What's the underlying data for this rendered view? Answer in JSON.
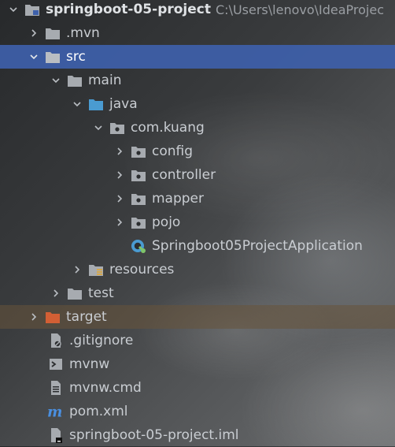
{
  "project": {
    "name": "springboot-05-project",
    "path": "C:\\Users\\lenovo\\IdeaProjec"
  },
  "tree": {
    "mvn": ".mvn",
    "src": "src",
    "main": "main",
    "java": "java",
    "package": "com.kuang",
    "config": "config",
    "controller": "controller",
    "mapper": "mapper",
    "pojo": "pojo",
    "app_class": "Springboot05ProjectApplication",
    "resources": "resources",
    "test": "test",
    "target": "target",
    "gitignore": ".gitignore",
    "mvnw": "mvnw",
    "mvnw_cmd": "mvnw.cmd",
    "pom": "pom.xml",
    "iml": "springboot-05-project.iml"
  },
  "colors": {
    "selection": "#3e60aa",
    "excluded_folder": "#d35f34",
    "source_folder": "#4a9bd1",
    "folder": "#a7abb0",
    "maven_icon": "#4a8fe0"
  }
}
